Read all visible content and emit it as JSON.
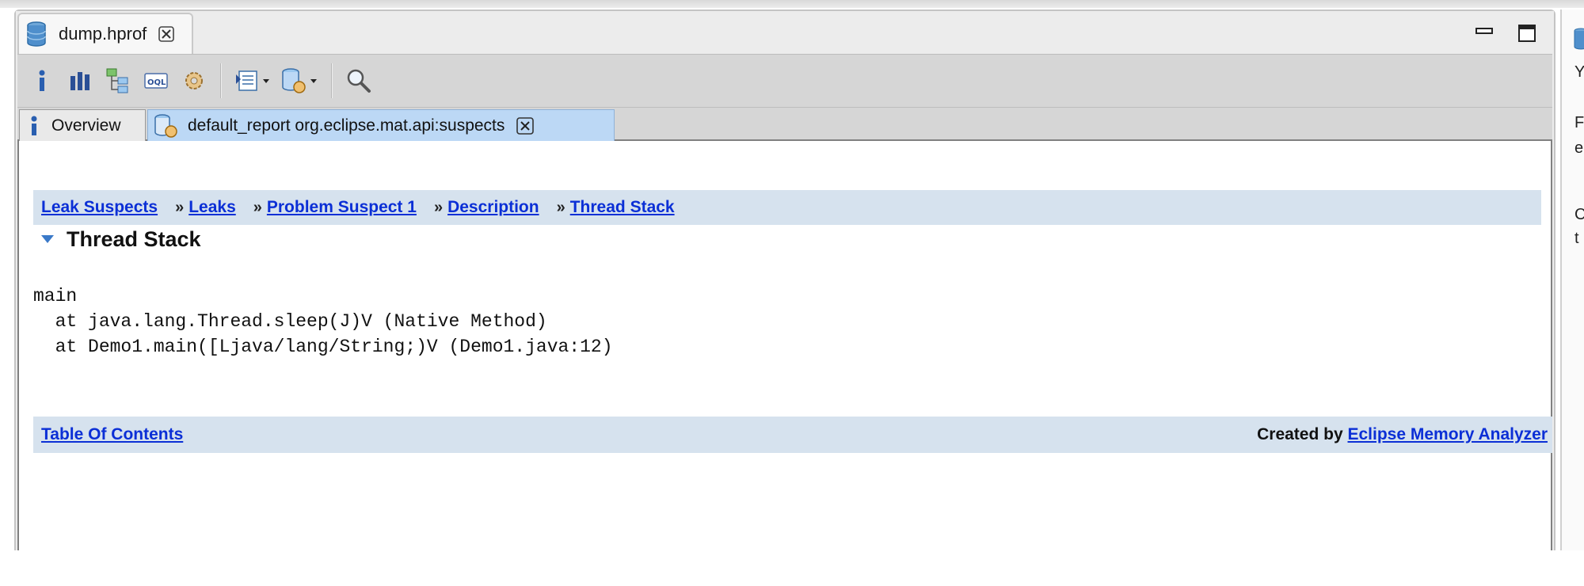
{
  "editor_tab": {
    "label": "dump.hprof",
    "icon": "database-icon"
  },
  "window_controls": {
    "minimize": "minimize-icon",
    "maximize": "maximize-icon"
  },
  "toolbar": {
    "items": [
      "info-icon",
      "histogram-icon",
      "dominator-tree-icon",
      "oql-icon",
      "thread-overview-icon",
      "query-browser-icon",
      "run-report-icon",
      "search-icon"
    ]
  },
  "subtabs": [
    {
      "label": "Overview",
      "icon": "info-icon"
    },
    {
      "label": "default_report  org.eclipse.mat.api:suspects",
      "icon": "report-icon",
      "active": true
    }
  ],
  "breadcrumb": {
    "items": [
      "Leak Suspects",
      "Leaks",
      "Problem Suspect 1",
      "Description",
      "Thread Stack"
    ],
    "separator": "»"
  },
  "section": {
    "title": "Thread Stack"
  },
  "stack": {
    "thread": "main",
    "frames": [
      "  at java.lang.Thread.sleep(J)V (Native Method)",
      "  at Demo1.main([Ljava/lang/String;)V (Demo1.java:12)"
    ]
  },
  "footer": {
    "toc_link": "Table Of Contents",
    "created_by": "Created by",
    "analyzer_link": "Eclipse Memory Analyzer"
  },
  "right_panel": {
    "fragments": [
      "Y",
      "F",
      "e",
      "C",
      "t"
    ]
  },
  "colors": {
    "link": "#0b2fd6",
    "bar": "#d6e2ee",
    "active_tab": "#bcd8f5"
  }
}
